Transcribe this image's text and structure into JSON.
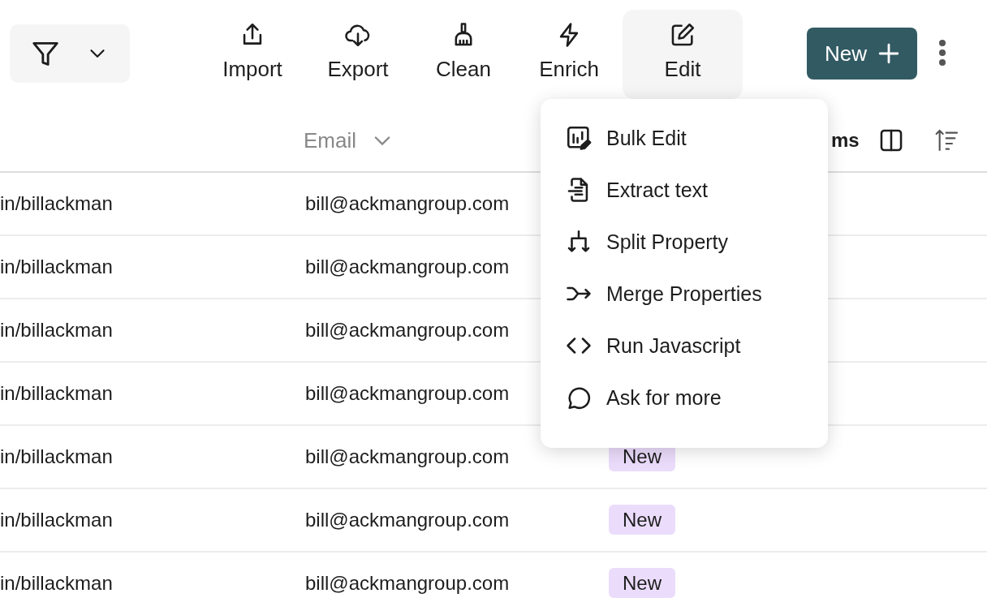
{
  "toolbar": {
    "actions": [
      {
        "label": "Import",
        "kind": "upload",
        "selected": false
      },
      {
        "label": "Export",
        "kind": "download",
        "selected": false
      },
      {
        "label": "Clean",
        "kind": "broom",
        "selected": false
      },
      {
        "label": "Enrich",
        "kind": "bolt",
        "selected": false
      },
      {
        "label": "Edit",
        "kind": "edit",
        "selected": true
      }
    ],
    "new_button": {
      "label": "New"
    }
  },
  "table": {
    "email_header": {
      "label": "Email"
    },
    "columns_control": {
      "label": "ms"
    },
    "rows": [
      {
        "column_1": "in/billackman",
        "email": "bill@ackmangroup.com"
      },
      {
        "column_1": "in/billackman",
        "email": "bill@ackmangroup.com"
      },
      {
        "column_1": "in/billackman",
        "email": "bill@ackmangroup.com"
      },
      {
        "column_1": "in/billackman",
        "email": "bill@ackmangroup.com"
      },
      {
        "column_1": "in/billackman",
        "email": "bill@ackmangroup.com",
        "status": "New"
      },
      {
        "column_1": "in/billackman",
        "email": "bill@ackmangroup.com",
        "status": "New"
      },
      {
        "column_1": "in/billackman",
        "email": "bill@ackmangroup.com",
        "status": "New"
      }
    ]
  },
  "edit_menu": {
    "items": [
      {
        "label": "Bulk Edit",
        "kind": "bulk"
      },
      {
        "label": "Extract text",
        "kind": "extract"
      },
      {
        "label": "Split Property",
        "kind": "split"
      },
      {
        "label": "Merge Properties",
        "kind": "merge"
      },
      {
        "label": "Run Javascript",
        "kind": "code"
      },
      {
        "label": "Ask for more",
        "kind": "chat"
      }
    ]
  }
}
